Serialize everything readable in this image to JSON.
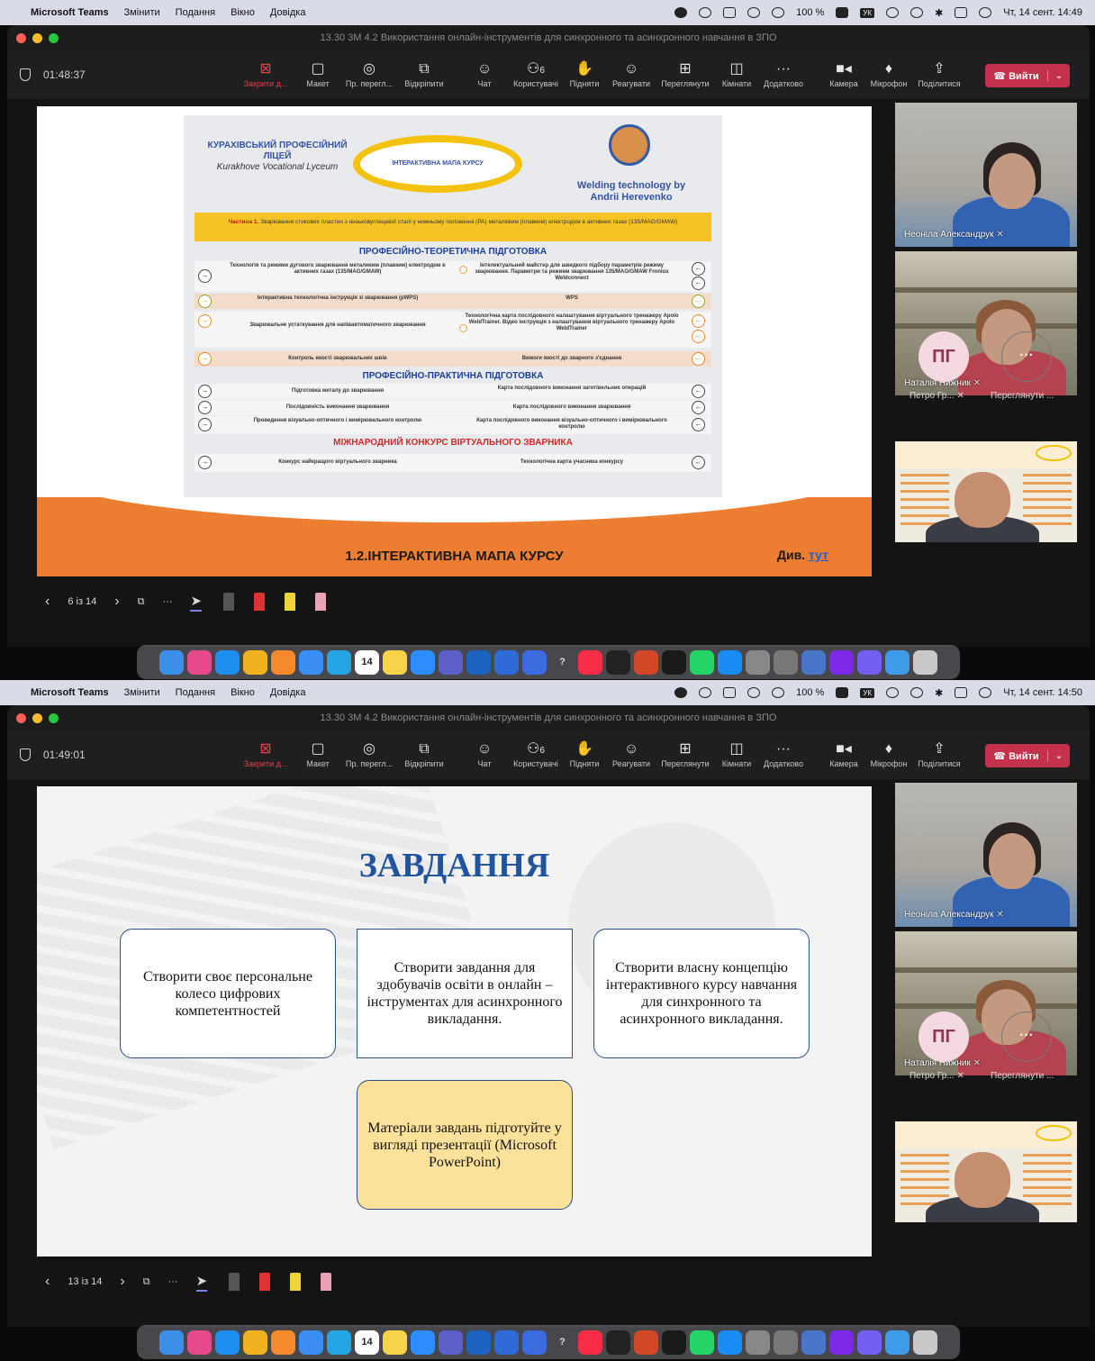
{
  "screens": [
    {
      "menubar": {
        "app": "Microsoft Teams",
        "menus": [
          "Змінити",
          "Подання",
          "Вікно",
          "Довідка"
        ],
        "battery": "100 %",
        "input_lang": "УК",
        "clock": "Чт, 14 сент.  14:49"
      },
      "window_title": "13.30 3М 4.2 Використання онлайн-інструментів для синхронного та асинхронного навчання в ЗПО",
      "timer": "01:48:37",
      "toolbar": {
        "stop": "Закрити д...",
        "layout": "Макет",
        "view": "Пр. перегл...",
        "unpin": "Відкріпити",
        "chat": "Чат",
        "people": "Користувачі",
        "people_count": "6",
        "raise": "Підняти",
        "react": "Реагувати",
        "view2": "Переглянути",
        "rooms": "Кімнати",
        "more": "Додатково",
        "camera": "Камера",
        "mic": "Мікрофон",
        "share": "Поділитися",
        "leave": "Вийти"
      },
      "slide": {
        "page": "6 із 14",
        "bottom_title": "1.2.ІНТЕРАКТИВНА МАПА КУРСУ",
        "see_prefix": "Див.",
        "see_link": "тут",
        "poster": {
          "school": "КУРАХІВСЬКИЙ ПРОФЕСІЙНИЙ ЛІЦЕЙ",
          "school_en": "Kurakhove Vocational Lyceum",
          "oval": "ІНТЕРАКТИВНА МАПА КУРСУ",
          "author": "Welding technology by Andrii Herevenko",
          "banner_prefix": "Частина 1.",
          "banner": "Зварювання стикових пластин з низьковуглецевої сталі у нижньому положенні (PA) металевим (плавким) електродом в активних газах (135/MAG/GMAW)",
          "sec_theory": "ПРОФЕСІЙНО-ТЕОРЕТИЧНА ПІДГОТОВКА",
          "sec_practice": "ПРОФЕСІЙНО-ПРАКТИЧНА ПІДГОТОВКА",
          "sec_contest": "МІЖНАРОДНИЙ КОНКУРС ВІРТУАЛЬНОГО ЗВАРНИКА",
          "rows": [
            {
              "l": "Технологія та режими дугового зварювання металевим (плавким) електродом в активних газах (135/MAG/GMAW)",
              "r": "Інтелектуальний майстер для швидкого підбору параметрів режиму зварювання. Параметри та режими зварювання 135/MAG/GMAW Fronius Weldconnect"
            },
            {
              "l": "Інтерактивна технологічна інструкція зі зварювання (pWPS)",
              "r": "WPS"
            },
            {
              "l": "Зварювальне устаткування для напівавтоматичного зварювання",
              "r": "Технологічна карта послідовного налаштування віртуального тренажеру Apolo WeldTrainer. Відео інструкція з налаштування віртуального тренажеру Apolo WeldTrainer"
            },
            {
              "l": "Контроль якості зварювальних швів",
              "r": "Вимоги якості до зварного з'єднання"
            },
            {
              "l": "Підготовка металу до зварювання",
              "r": "Карта послідовного виконання заготівельних операцій"
            },
            {
              "l": "Послідовність виконання зварювання",
              "r": "Карта послідовного виконання зварювання"
            },
            {
              "l": "Проведення візуально-оптичного і вимірювального контролю",
              "r": "Карта послідовного виконання візуально-оптичного і вимірювального контролю"
            },
            {
              "l": "Конкурс найкращого віртуального зварника",
              "r": "Технологічна карта учасника конкурсу"
            }
          ]
        }
      },
      "participants": {
        "p1": "Неоніла Александрук",
        "p2": "Наталія Нижник",
        "pg_initials": "ПГ",
        "pg_name": "Петро Гр...",
        "more_glyph": "···",
        "more_name": "Переглянути ..."
      }
    },
    {
      "menubar": {
        "app": "Microsoft Teams",
        "menus": [
          "Змінити",
          "Подання",
          "Вікно",
          "Довідка"
        ],
        "battery": "100 %",
        "input_lang": "УК",
        "clock": "Чт, 14 сент.  14:50"
      },
      "window_title": "13.30 3М 4.2 Використання онлайн-інструментів для синхронного та асинхронного навчання в ЗПО",
      "timer": "01:49:01",
      "toolbar": {
        "stop": "Закрити д...",
        "layout": "Макет",
        "view": "Пр. перегл...",
        "unpin": "Відкріпити",
        "chat": "Чат",
        "people": "Користувачі",
        "people_count": "6",
        "raise": "Підняти",
        "react": "Реагувати",
        "view2": "Переглянути",
        "rooms": "Кімнати",
        "more": "Додатково",
        "camera": "Камера",
        "mic": "Мікрофон",
        "share": "Поділитися",
        "leave": "Вийти"
      },
      "slide": {
        "page": "13 із 14",
        "title": "ЗАВДАННЯ",
        "box1": "Створити своє персональне колесо цифрових компетентностей",
        "box2": "Створити завдання для здобувачів освіти в онлайн – інструментах для асинхронного викладання.",
        "box3": "Створити власну концепцію інтерактивного курсу навчання для синхронного та асинхронного викладання.",
        "box4": "Матеріали завдань підготуйте у вигляді презентації (Microsoft PowerPoint)"
      },
      "participants": {
        "p1": "Неоніла Александрук",
        "p2": "Наталія Нижник",
        "pg_initials": "ПГ",
        "pg_name": "Петро Гр...",
        "more_glyph": "···",
        "more_name": "Переглянути ..."
      }
    }
  ],
  "dock_calendar_day": "14",
  "colors": {
    "teams_leave": "#c4314b",
    "slide_orange": "#ed7d31",
    "task_title": "#20549e",
    "note_yellow": "#fbe19a"
  }
}
